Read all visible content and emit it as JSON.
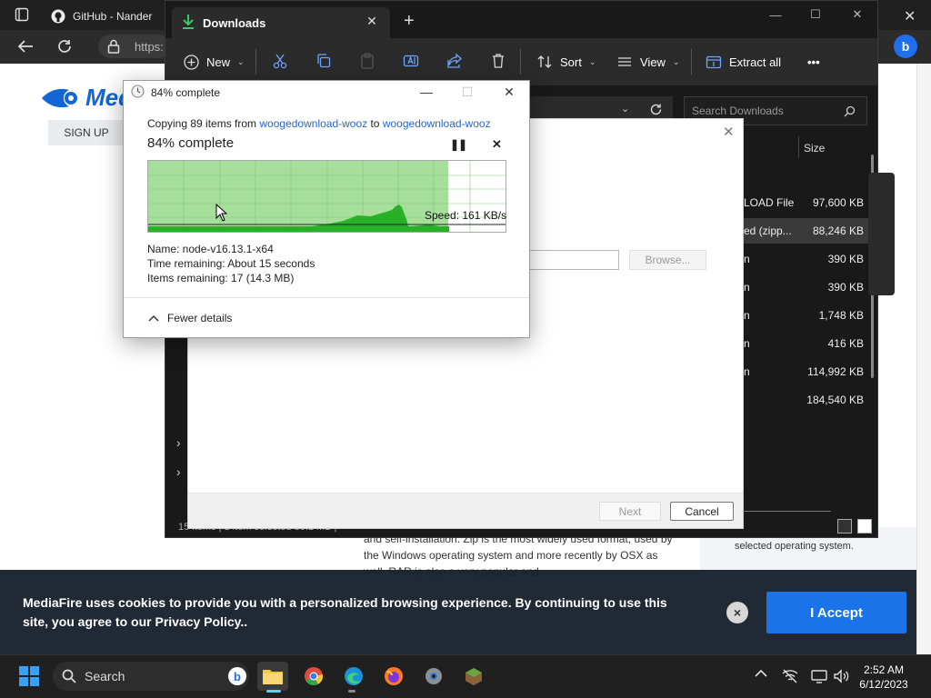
{
  "browser": {
    "tab_title": "GitHub - Nander",
    "url_fragment": "https:",
    "site_logo": "Med",
    "signup_label": "SIGN UP"
  },
  "webpage": {
    "body_text": "and self-installation. Zip is the most widely used format, used by the Windows operating system and more recently by OSX as well. RAR is also a very popular and",
    "side_text": "selected operating system."
  },
  "cookie_banner": {
    "message": "MediaFire uses cookies to provide you with a personalized browsing experience. By continuing to use this site, you agree to our Privacy Policy..",
    "accept_label": "I Accept",
    "close_label": "×"
  },
  "explorer": {
    "tab_title": "Downloads",
    "toolbar": {
      "new_label": "New",
      "sort_label": "Sort",
      "view_label": "View",
      "extract_label": "Extract all",
      "more_label": "•••"
    },
    "search_placeholder": "Search Downloads",
    "size_header": "Size",
    "rows": [
      {
        "type": "LOAD File",
        "size": "97,600 KB"
      },
      {
        "type": "ed (zipp...",
        "size": "88,246 KB"
      },
      {
        "type": "n",
        "size": "390 KB"
      },
      {
        "type": "n",
        "size": "390 KB"
      },
      {
        "type": "n",
        "size": "1,748 KB"
      },
      {
        "type": "n",
        "size": "416 KB"
      },
      {
        "type": "n",
        "size": "114,992 KB"
      },
      {
        "type": "",
        "size": "184,540 KB"
      }
    ],
    "status_text": "15 items | 1 item selected 86.1 MB |"
  },
  "wizard": {
    "browse_label": "Browse...",
    "next_label": "Next",
    "cancel_label": "Cancel"
  },
  "copy_dialog": {
    "title": "84% complete",
    "copying_prefix": "Copying 89 items from ",
    "source": "woogedownload-wooz",
    "to_word": " to ",
    "destination": "woogedownload-wooz",
    "percent_text": "84% complete",
    "progress": 0.84,
    "speed_text": "Speed: 161 KB/s",
    "name_text": "Name:  node-v16.13.1-x64",
    "time_text": "Time remaining:  About 15 seconds",
    "items_text": "Items remaining:  17 (14.3 MB)",
    "fewer_details": "Fewer details",
    "colors": {
      "fill": "#a6df9b",
      "grid": "#7fc874",
      "speed_area": "#28b028"
    }
  },
  "taskbar": {
    "search_label": "Search",
    "time": "2:52 AM",
    "date": "6/12/2023"
  },
  "colors": {
    "accent_blue": "#1a73e8",
    "explorer_bg": "#191919",
    "cookie_bg": "#18202c"
  }
}
